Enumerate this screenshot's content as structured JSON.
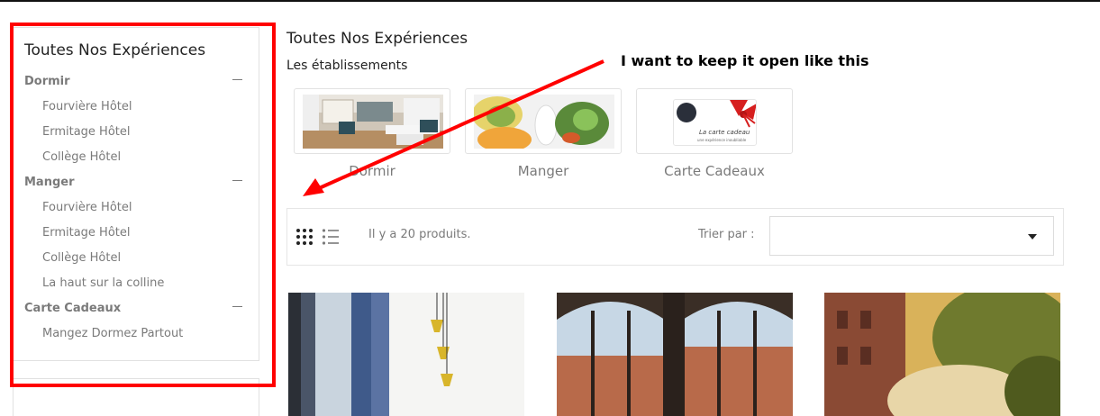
{
  "sidebar": {
    "title": "Toutes Nos Expériences",
    "categories": [
      {
        "label": "Dormir",
        "items": [
          "Fourvière Hôtel",
          "Ermitage Hôtel",
          "Collège Hôtel"
        ]
      },
      {
        "label": "Manger",
        "items": [
          "Fourvière Hôtel",
          "Ermitage Hôtel",
          "Collège Hôtel",
          "La haut sur la colline"
        ]
      },
      {
        "label": "Carte Cadeaux",
        "items": [
          "Mangez Dormez Partout"
        ]
      }
    ]
  },
  "main": {
    "title": "Toutes Nos Expériences",
    "establishments_label": "Les établissements",
    "establishments": [
      {
        "name": "Dormir"
      },
      {
        "name": "Manger"
      },
      {
        "name": "Carte Cadeaux",
        "card_title": "La carte cadeau",
        "card_subtitle": "une expérience inoubliable"
      }
    ]
  },
  "annotation": "I want to keep it open like this",
  "toolbar": {
    "product_count": "Il y a 20 produits.",
    "sort_label": "Trier par :",
    "sort_value": ""
  },
  "colors": {
    "highlight": "#ff0000",
    "muted_text": "#7a7a7a",
    "border": "#e1e1e1"
  },
  "icons": [
    "grid-view-icon",
    "list-view-icon",
    "dropdown-caret-icon",
    "collapse-minus-icon"
  ]
}
